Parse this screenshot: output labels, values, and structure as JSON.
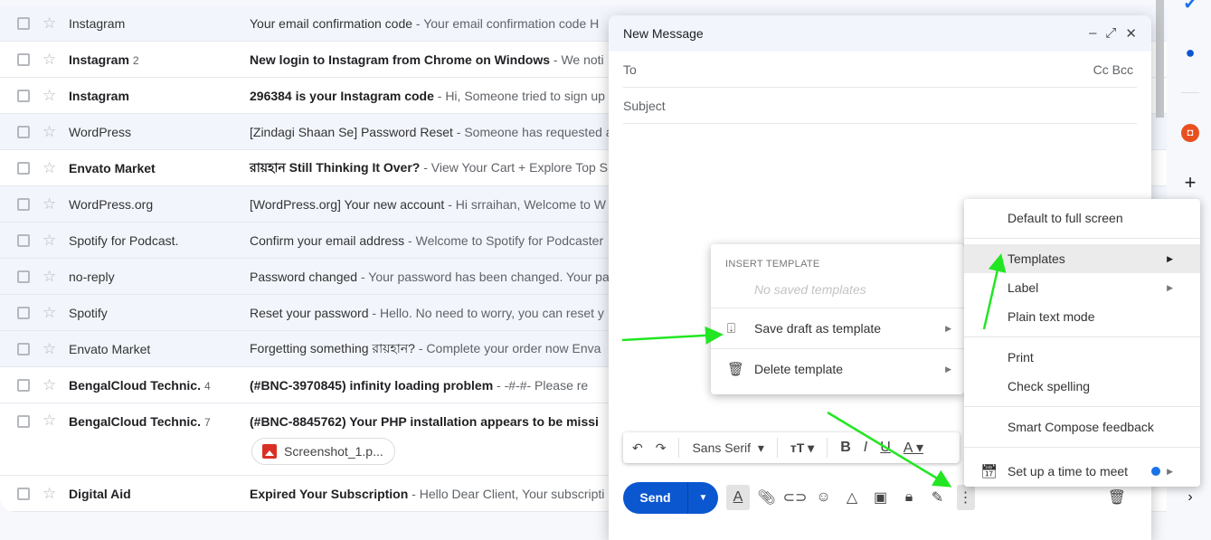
{
  "emails": [
    {
      "sender": "Instagram",
      "count": "",
      "subject": "Your email confirmation code",
      "snippet": " - Your email confirmation code H",
      "unread": false
    },
    {
      "sender": "Instagram",
      "count": "2",
      "subject": "New login to Instagram from Chrome on Windows",
      "snippet": " - We noti",
      "unread": true
    },
    {
      "sender": "Instagram",
      "count": "",
      "subject": "296384 is your Instagram code",
      "snippet": " - Hi, Someone tried to sign up",
      "unread": true
    },
    {
      "sender": "WordPress",
      "count": "",
      "subject": "[Zindagi Shaan Se] Password Reset",
      "snippet": " - Someone has requested a",
      "unread": false
    },
    {
      "sender": "Envato Market",
      "count": "",
      "subject": "রায়হান Still Thinking It Over?",
      "snippet": " - View Your Cart + Explore Top S",
      "unread": true
    },
    {
      "sender": "WordPress.org",
      "count": "",
      "subject": "[WordPress.org] Your new account",
      "snippet": " - Hi srraihan, Welcome to W",
      "unread": false
    },
    {
      "sender": "Spotify for Podcast.",
      "count": "",
      "subject": "Confirm your email address",
      "snippet": " - Welcome to Spotify for Podcaster",
      "unread": false
    },
    {
      "sender": "no-reply",
      "count": "",
      "subject": "Password changed",
      "snippet": " - Your password has been changed. Your pa",
      "unread": false
    },
    {
      "sender": "Spotify",
      "count": "",
      "subject": "Reset your password",
      "snippet": " - Hello. No need to worry, you can reset y",
      "unread": false
    },
    {
      "sender": "Envato Market",
      "count": "",
      "subject": "Forgetting something রায়হান?",
      "snippet": " - Complete your order now Enva",
      "unread": false
    },
    {
      "sender": "BengalCloud Technic.",
      "count": "4",
      "subject": "(#BNC-3970845) infinity loading problem",
      "snippet": " - -#-#- Please re",
      "unread": true
    },
    {
      "sender": "BengalCloud Technic.",
      "count": "7",
      "subject": "(#BNC-8845762) Your PHP installation appears to be missi",
      "snippet": "",
      "unread": true,
      "attachment": "Screenshot_1.p..."
    },
    {
      "sender": "Digital Aid",
      "count": "",
      "subject": "Expired Your Subscription",
      "snippet": " - Hello Dear Client, Your subscripti",
      "unread": true
    }
  ],
  "compose": {
    "title": "New Message",
    "to_label": "To",
    "cc_bcc": "Cc Bcc",
    "subject_placeholder": "Subject",
    "send_label": "Send",
    "font": "Sans Serif"
  },
  "templates_menu": {
    "header": "INSERT TEMPLATE",
    "empty": "No saved templates",
    "items": [
      "Save draft as template",
      "Delete template"
    ]
  },
  "more_menu": {
    "items": [
      "Default to full screen",
      "Templates",
      "Label",
      "Plain text mode",
      "Print",
      "Check spelling",
      "Smart Compose feedback",
      "Set up a time to meet"
    ]
  },
  "colors": {
    "accent": "#0b57d0",
    "arrow": "#22e622"
  }
}
